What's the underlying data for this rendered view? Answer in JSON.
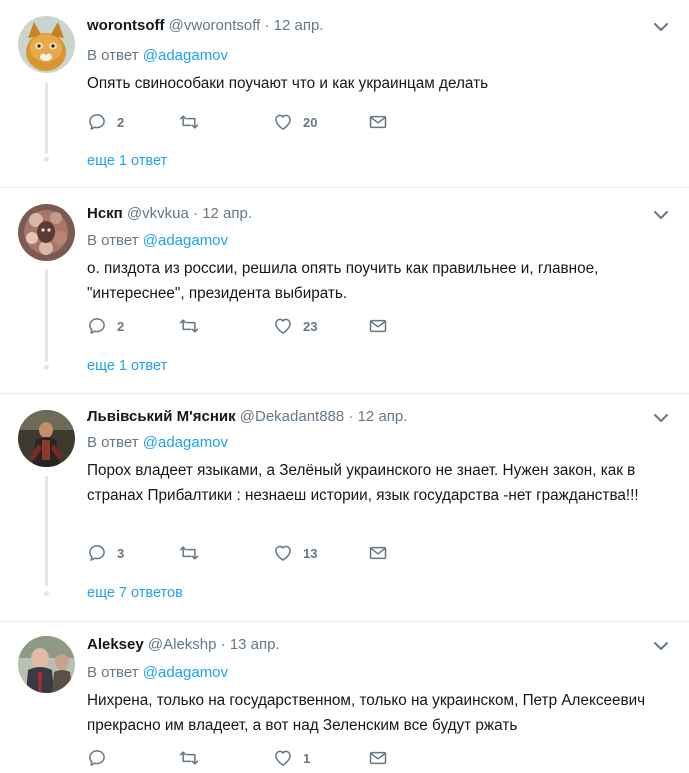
{
  "colors": {
    "accent": "#1da1f2",
    "muted": "#657786",
    "text": "#14171a",
    "divider": "#e6ecf0"
  },
  "icons": {
    "reply": "reply-icon",
    "retweet": "retweet-icon",
    "like": "heart-icon",
    "dm": "envelope-icon",
    "menu": "chevron-down-icon"
  },
  "tweets": [
    {
      "fullname": "worontsoff",
      "username": "@vworontsoff",
      "sep": "·",
      "time": "12 апр.",
      "reply_prefix": "В ответ",
      "reply_mention": "@adagamov",
      "text": "Опять свинособаки поучают что и как украинцам делать",
      "replies": "2",
      "retweets": "",
      "likes": "20",
      "more": "еще 1 ответ"
    },
    {
      "fullname": "Нскп",
      "username": "@vkvkua",
      "sep": "·",
      "time": "12 апр.",
      "reply_prefix": "В ответ",
      "reply_mention": "@adagamov",
      "text": "о. пиздота из россии, решила опять поучить как правильнее и, главное, \"интереснее\", президента выбирать.",
      "replies": "2",
      "retweets": "",
      "likes": "23",
      "more": "еще 1 ответ"
    },
    {
      "fullname": "Львівський М'ясник",
      "username": "@Dekadant888",
      "sep": "·",
      "time": "12 апр.",
      "reply_prefix": "В ответ",
      "reply_mention": "@adagamov",
      "text": "Порох владеет языками, а Зелёный украинского не знает.  Нужен закон, как в странах Прибалтики : незнаеш истории,  язык государства -нет гражданства!!!",
      "replies": "3",
      "retweets": "",
      "likes": "13",
      "more": "еще 7 ответов"
    },
    {
      "fullname": "Aleksey",
      "username": "@Alekshp",
      "sep": "·",
      "time": "13 апр.",
      "reply_prefix": "В ответ",
      "reply_mention": "@adagamov",
      "text": "Нихрена, только на государственном, только на украинском, Петр Алексеевич прекрасно им владеет, а вот над Зеленским все будут ржать",
      "replies": "",
      "retweets": "",
      "likes": "1",
      "more": ""
    }
  ]
}
